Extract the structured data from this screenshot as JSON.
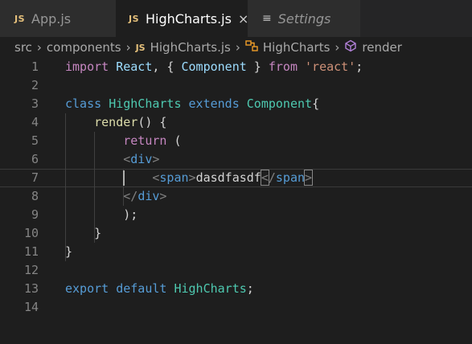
{
  "tabs": [
    {
      "badge": "JS",
      "label": "App.js",
      "active": false
    },
    {
      "badge": "JS",
      "label": "HighCharts.js",
      "active": true,
      "close": "×"
    },
    {
      "icon": "≡",
      "label": "Settings",
      "active": false
    }
  ],
  "breadcrumb": {
    "items": [
      "src",
      "components",
      "HighCharts.js",
      "HighCharts",
      "render"
    ],
    "js_badge": "JS",
    "separator": "›"
  },
  "editor": {
    "line_numbers": [
      "1",
      "2",
      "3",
      "4",
      "5",
      "6",
      "7",
      "8",
      "9",
      "10",
      "11",
      "12",
      "13",
      "14"
    ],
    "current_line": 7,
    "lines": [
      [
        {
          "t": "kw",
          "v": "import"
        },
        {
          "t": "punct",
          "v": " "
        },
        {
          "t": "ident",
          "v": "React"
        },
        {
          "t": "punct",
          "v": ", { "
        },
        {
          "t": "ident",
          "v": "Component"
        },
        {
          "t": "punct",
          "v": " } "
        },
        {
          "t": "kw",
          "v": "from"
        },
        {
          "t": "punct",
          "v": " "
        },
        {
          "t": "str",
          "v": "'react'"
        },
        {
          "t": "punct",
          "v": ";"
        }
      ],
      [],
      [
        {
          "t": "kw2",
          "v": "class"
        },
        {
          "t": "punct",
          "v": " "
        },
        {
          "t": "cls",
          "v": "HighCharts"
        },
        {
          "t": "punct",
          "v": " "
        },
        {
          "t": "kw2",
          "v": "extends"
        },
        {
          "t": "punct",
          "v": " "
        },
        {
          "t": "cls",
          "v": "Component"
        },
        {
          "t": "punct",
          "v": "{"
        }
      ],
      [
        {
          "t": "punct",
          "v": "    "
        },
        {
          "t": "fn",
          "v": "render"
        },
        {
          "t": "punct",
          "v": "() {"
        }
      ],
      [
        {
          "t": "punct",
          "v": "        "
        },
        {
          "t": "kw",
          "v": "return"
        },
        {
          "t": "punct",
          "v": " ("
        }
      ],
      [
        {
          "t": "punct",
          "v": "        "
        },
        {
          "t": "tagbr",
          "v": "<"
        },
        {
          "t": "tagname",
          "v": "div"
        },
        {
          "t": "tagbr",
          "v": ">"
        }
      ],
      [
        {
          "t": "punct",
          "v": "            "
        },
        {
          "t": "tagbr",
          "v": "<"
        },
        {
          "t": "tagname",
          "v": "span"
        },
        {
          "t": "tagbr",
          "v": ">"
        },
        {
          "t": "text",
          "v": "dasdfasdf"
        },
        {
          "t": "tagbr hl",
          "v": "<"
        },
        {
          "t": "tagbr",
          "v": "/"
        },
        {
          "t": "tagname",
          "v": "span"
        },
        {
          "t": "tagbr hl",
          "v": ">"
        }
      ],
      [
        {
          "t": "punct",
          "v": "        "
        },
        {
          "t": "tagbr",
          "v": "</"
        },
        {
          "t": "tagname",
          "v": "div"
        },
        {
          "t": "tagbr",
          "v": ">"
        }
      ],
      [
        {
          "t": "punct",
          "v": "        );"
        }
      ],
      [
        {
          "t": "punct",
          "v": "    }"
        }
      ],
      [
        {
          "t": "punct",
          "v": "}"
        }
      ],
      [],
      [
        {
          "t": "kw2",
          "v": "export"
        },
        {
          "t": "punct",
          "v": " "
        },
        {
          "t": "kw2",
          "v": "default"
        },
        {
          "t": "punct",
          "v": " "
        },
        {
          "t": "cls",
          "v": "HighCharts"
        },
        {
          "t": "punct",
          "v": ";"
        }
      ],
      []
    ]
  }
}
